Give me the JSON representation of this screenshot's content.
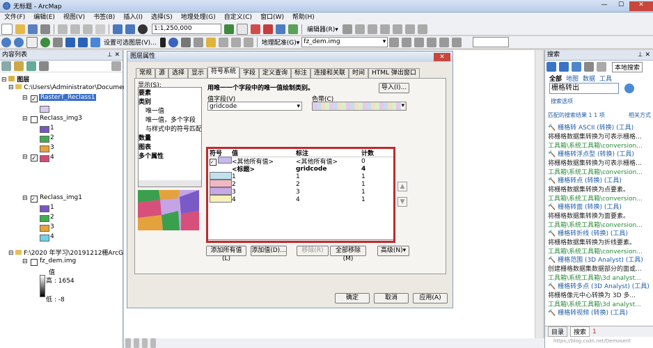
{
  "window": {
    "title": "无标题 - ArcMap"
  },
  "menu": [
    "文件(F)",
    "编辑(E)",
    "视图(V)",
    "书签(B)",
    "插入(I)",
    "选择(S)",
    "地理处理(G)",
    "自定义(C)",
    "窗口(W)",
    "帮助(H)"
  ],
  "toolbar": {
    "scale": "1:1,250,000",
    "editor_label": "编辑器(R)▾",
    "page_layout": "设置可选图层(V)...",
    "georef_label": "地理配准(G)▾",
    "georef_layer": "fz_dem.img"
  },
  "toc": {
    "title": "内容列表",
    "root": "图层",
    "workspace1": "C:\\Users\\Administrator\\Documen",
    "layer1": "RasterT_Reclass1",
    "layer2": "Reclass_img3",
    "layer2_values": [
      "1",
      "2",
      "3",
      "4"
    ],
    "layer3": "Reclass_img1",
    "layer3_values": [
      "1",
      "2",
      "3",
      "4"
    ],
    "workspace2": "F:\\2020 年学习\\20191212栅ArcGI",
    "layer4": "fz_dem.img",
    "layer4_value_label": "值",
    "layer4_high": "高 : 1654",
    "layer4_low": "低 : -8"
  },
  "dialog": {
    "title": "图层属性",
    "tabs": [
      "常规",
      "源",
      "选择",
      "显示",
      "符号系统",
      "字段",
      "定义查询",
      "标注",
      "连接和关联",
      "时间",
      "HTML 弹出窗口"
    ],
    "active_tab": "符号系统",
    "show_label": "显示(S):",
    "show_items": [
      "要素",
      "类别",
      "唯一值",
      "唯一值，多个字段",
      "与样式中的符号匹配",
      "数量",
      "图表",
      "多个属性"
    ],
    "heading": "用唯一一个字段中的唯一值绘制类别。",
    "import_btn": "导入(I)...",
    "value_field_label": "值字段(V)",
    "value_field": "gridcode",
    "color_ramp_label": "色带(C)",
    "table_headers": [
      "符号",
      "值",
      "标注",
      "计数"
    ],
    "rows": [
      {
        "value": "<其他所有值>",
        "label": "<其他所有值>",
        "count": "0"
      },
      {
        "value": "<标题>",
        "label": "gridcode",
        "count": "4"
      },
      {
        "value": "1",
        "label": "1",
        "count": "1"
      },
      {
        "value": "2",
        "label": "2",
        "count": "1"
      },
      {
        "value": "3",
        "label": "3",
        "count": "1"
      },
      {
        "value": "4",
        "label": "4",
        "count": "1"
      }
    ],
    "btn_add_all": "添加所有值(L)",
    "btn_add": "添加值(D)...",
    "btn_remove": "移除(R)",
    "btn_remove_all": "全部移除(M)",
    "btn_advanced": "高级(N)▾",
    "btn_ok": "确定",
    "btn_cancel": "取消",
    "btn_apply": "应用(A)"
  },
  "search": {
    "title": "搜索",
    "mode": "本地搜索",
    "filters": [
      "全部",
      "地图",
      "数据",
      "工具"
    ],
    "query": "栅格转出",
    "options": "搜索选项",
    "suggest": "匹配的搜索结果 1 1 项",
    "sort": "相关方式",
    "results": [
      {
        "title": "栅格转 ASCII (转换) (工具)",
        "desc": "将栅格数据集转换为可表示栅格...",
        "path": "工具箱\\系统工具箱\\conversion..."
      },
      {
        "title": "栅格转浮点型 (转换) (工具)",
        "desc": "将栅格数据集转换为可表示栅格...",
        "path": "工具箱\\系统工具箱\\conversion..."
      },
      {
        "title": "栅格转点 (转换) (工具)",
        "desc": "将栅格数据集转换为点要素。",
        "path": "工具箱\\系统工具箱\\conversion..."
      },
      {
        "title": "栅格转面 (转换) (工具)",
        "desc": "将栅格数据集转换为面要素。",
        "path": "工具箱\\系统工具箱\\conversion..."
      },
      {
        "title": "栅格转折线 (转换) (工具)",
        "desc": "将栅格数据集转换为折线要素。",
        "path": "工具箱\\系统工具箱\\conversion..."
      },
      {
        "title": "栅格范围 (3D Analyst) (工具)",
        "desc": "创建栅格数据集数据部分的面或...",
        "path": "工具箱\\系统工具箱\\3d analyst..."
      },
      {
        "title": "栅格转多点 (3D Analyst) (工具)",
        "desc": "将栅格像元中心转换为 3D 多...",
        "path": "工具箱\\系统工具箱\\3d analyst..."
      },
      {
        "title": "栅格转视频 (转换) (工具)",
        "desc": "",
        "path": ""
      }
    ],
    "bottom_tabs": [
      "目录",
      "搜索"
    ],
    "watermark": "https://blog.csdn.net/Demosent",
    "page_num": "1"
  },
  "colors": {
    "selected": "#3a6fc8",
    "highlight_border": "#c0292d"
  }
}
